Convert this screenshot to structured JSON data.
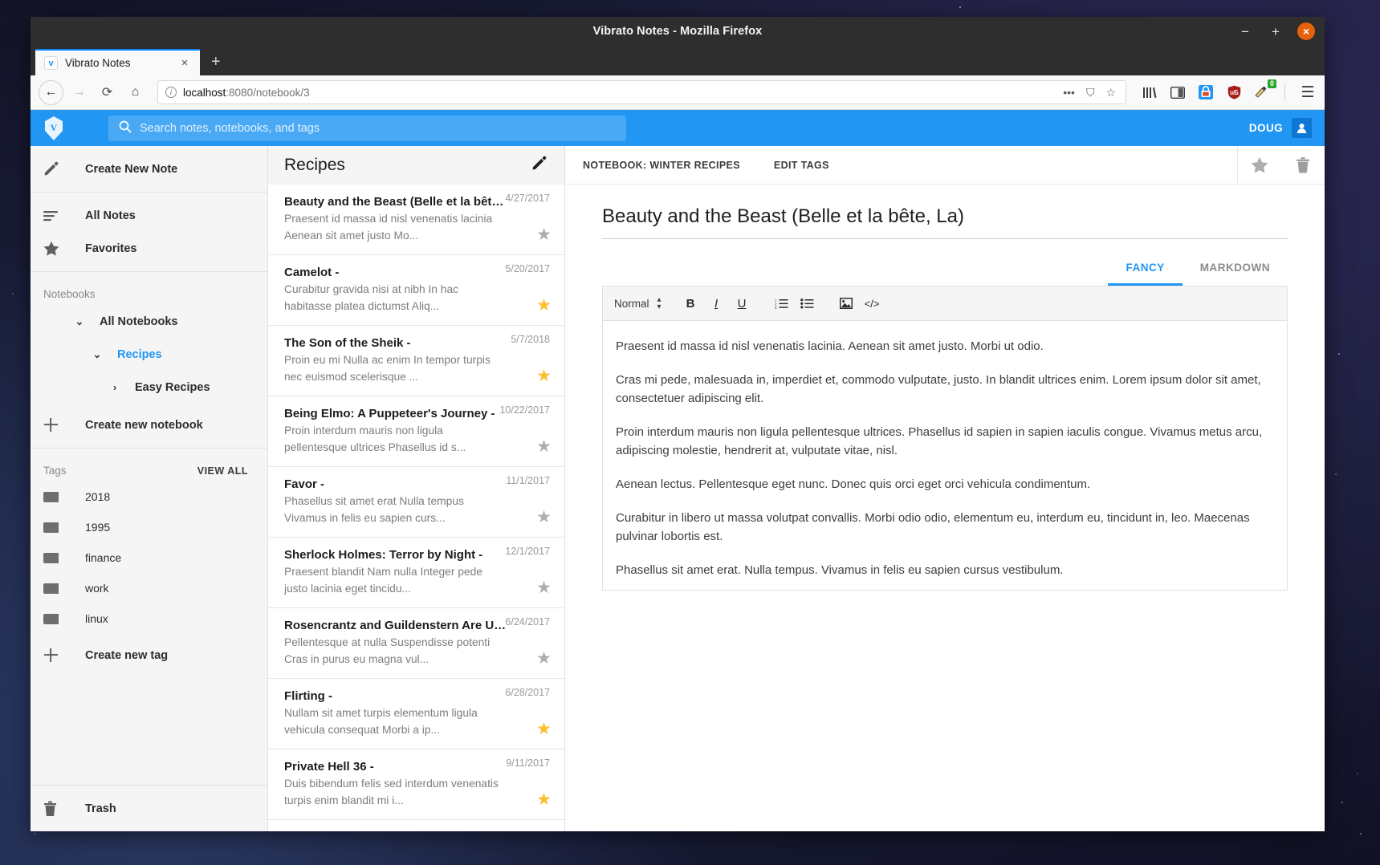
{
  "browser": {
    "window_title": "Vibrato Notes - Mozilla Firefox",
    "minimize": "−",
    "maximize": "+",
    "close": "×",
    "tab": {
      "favicon_letter": "v",
      "title": "Vibrato Notes",
      "close": "×"
    },
    "new_tab": "+",
    "nav": {
      "back": "←",
      "forward": "→",
      "reload": "⟳",
      "home": "⌂"
    },
    "url": {
      "host": "localhost",
      "rest": ":8080/notebook/3",
      "info_icon": "i",
      "page_actions": "•••",
      "pocket": "⛉",
      "bookmark": "☆"
    },
    "toolbar_icons": [
      "library-icon",
      "sidebar-icon",
      "save-to-pocket-icon",
      "ublock-icon",
      "extension-icon",
      "menu-icon"
    ],
    "ublock_badge": "0",
    "menu": "☰"
  },
  "appbar": {
    "logo_letter": "V",
    "search_placeholder": "Search notes, notebooks, and tags",
    "search_value": "",
    "user_name": "DOUG",
    "accent": "#2196f3"
  },
  "sidebar": {
    "create_note": {
      "label": "Create New Note",
      "icon": "pencil-icon"
    },
    "nav": [
      {
        "label": "All Notes",
        "icon": "list-icon"
      },
      {
        "label": "Favorites",
        "icon": "star-icon"
      }
    ],
    "notebooks_label": "Notebooks",
    "notebooks": [
      {
        "label": "All Notebooks",
        "level": 0,
        "chevron": "⌄",
        "active": false
      },
      {
        "label": "Recipes",
        "level": 1,
        "chevron": "⌄",
        "active": true
      },
      {
        "label": "Easy Recipes",
        "level": 2,
        "chevron": "›",
        "active": false
      }
    ],
    "create_notebook": {
      "label": "Create new notebook",
      "icon": "plus-icon"
    },
    "tags_label": "Tags",
    "view_all": "VIEW ALL",
    "tags": [
      "2018",
      "1995",
      "finance",
      "work",
      "linux"
    ],
    "create_tag": {
      "label": "Create new tag",
      "icon": "plus-icon"
    },
    "trash": {
      "label": "Trash",
      "icon": "trash-icon"
    }
  },
  "notelist": {
    "title": "Recipes",
    "edit_icon": "pencil-icon",
    "notes": [
      {
        "title": "Beauty and the Beast (Belle et la bête, La)",
        "date": "4/27/2017",
        "snippet": "Praesent id massa id nisl venenatis lacinia Aenean sit amet justo Mo...",
        "favorite": false,
        "selected": true
      },
      {
        "title": "Camelot -",
        "date": "5/20/2017",
        "snippet": "Curabitur gravida nisi at nibh In hac habitasse platea dictumst Aliq...",
        "favorite": true,
        "selected": false
      },
      {
        "title": "The Son of the Sheik -",
        "date": "5/7/2018",
        "snippet": "Proin eu mi Nulla ac enim In tempor turpis nec euismod scelerisque ...",
        "favorite": true,
        "selected": false
      },
      {
        "title": "Being Elmo: A Puppeteer's Journey -",
        "date": "10/22/2017",
        "snippet": "Proin interdum mauris non ligula pellentesque ultrices Phasellus id s...",
        "favorite": false,
        "selected": false
      },
      {
        "title": "Favor -",
        "date": "11/1/2017",
        "snippet": "Phasellus sit amet erat Nulla tempus Vivamus in felis eu sapien curs...",
        "favorite": false,
        "selected": false
      },
      {
        "title": "Sherlock Holmes: Terror by Night -",
        "date": "12/1/2017",
        "snippet": "Praesent blandit Nam nulla Integer pede justo lacinia eget tincidu...",
        "favorite": false,
        "selected": false
      },
      {
        "title": "Rosencrantz and Guildenstern Are Undead",
        "date": "6/24/2017",
        "snippet": "Pellentesque at nulla Suspendisse potenti Cras in purus eu magna vul...",
        "favorite": false,
        "selected": false
      },
      {
        "title": "Flirting -",
        "date": "6/28/2017",
        "snippet": "Nullam sit amet turpis elementum ligula vehicula consequat Morbi a ip...",
        "favorite": true,
        "selected": false
      },
      {
        "title": "Private Hell 36 -",
        "date": "9/11/2017",
        "snippet": "Duis bibendum felis sed interdum venenatis turpis enim blandit mi i...",
        "favorite": true,
        "selected": false
      }
    ]
  },
  "editor": {
    "notebook_button": "NOTEBOOK: WINTER RECIPES",
    "edit_tags_button": "EDIT TAGS",
    "favorite_icon": "star-icon",
    "delete_icon": "trash-icon",
    "note_title": "Beauty and the Beast (Belle et la bête, La)",
    "tabs": [
      {
        "label": "FANCY",
        "active": true
      },
      {
        "label": "MARKDOWN",
        "active": false
      }
    ],
    "toolbar": {
      "format_select": "Normal",
      "bold": "B",
      "italic": "I",
      "underline": "U",
      "ordered_list": "ordered-list-icon",
      "bullet_list": "bullet-list-icon",
      "image": "image-icon",
      "code": "</>"
    },
    "paragraphs": [
      "Praesent id massa id nisl venenatis lacinia. Aenean sit amet justo. Morbi ut odio.",
      "Cras mi pede, malesuada in, imperdiet et, commodo vulputate, justo. In blandit ultrices enim. Lorem ipsum dolor sit amet, consectetuer adipiscing elit.",
      "Proin interdum mauris non ligula pellentesque ultrices. Phasellus id sapien in sapien iaculis congue. Vivamus metus arcu, adipiscing molestie, hendrerit at, vulputate vitae, nisl.",
      "Aenean lectus. Pellentesque eget nunc. Donec quis orci eget orci vehicula condimentum.",
      "Curabitur in libero ut massa volutpat convallis. Morbi odio odio, elementum eu, interdum eu, tincidunt in, leo. Maecenas pulvinar lobortis est.",
      "Phasellus sit amet erat. Nulla tempus. Vivamus in felis eu sapien cursus vestibulum."
    ]
  }
}
